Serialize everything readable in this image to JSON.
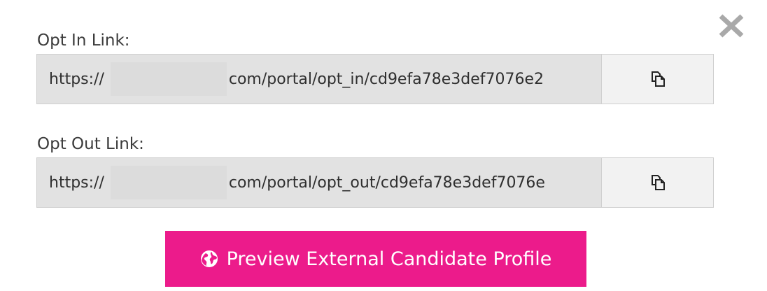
{
  "dialog": {
    "close_icon": "close-icon"
  },
  "opt_in": {
    "label": "Opt In Link:",
    "url_prefix": "https://",
    "url_rest": "com/portal/opt_in/cd9efa78e3def7076e2",
    "copy_icon": "copy-icon"
  },
  "opt_out": {
    "label": "Opt Out Link:",
    "url_prefix": "https://",
    "url_rest": "com/portal/opt_out/cd9efa78e3def7076e",
    "copy_icon": "copy-icon"
  },
  "preview": {
    "label": "Preview External Candidate Profile",
    "icon": "globe-icon",
    "color": "#ec1b8b"
  }
}
